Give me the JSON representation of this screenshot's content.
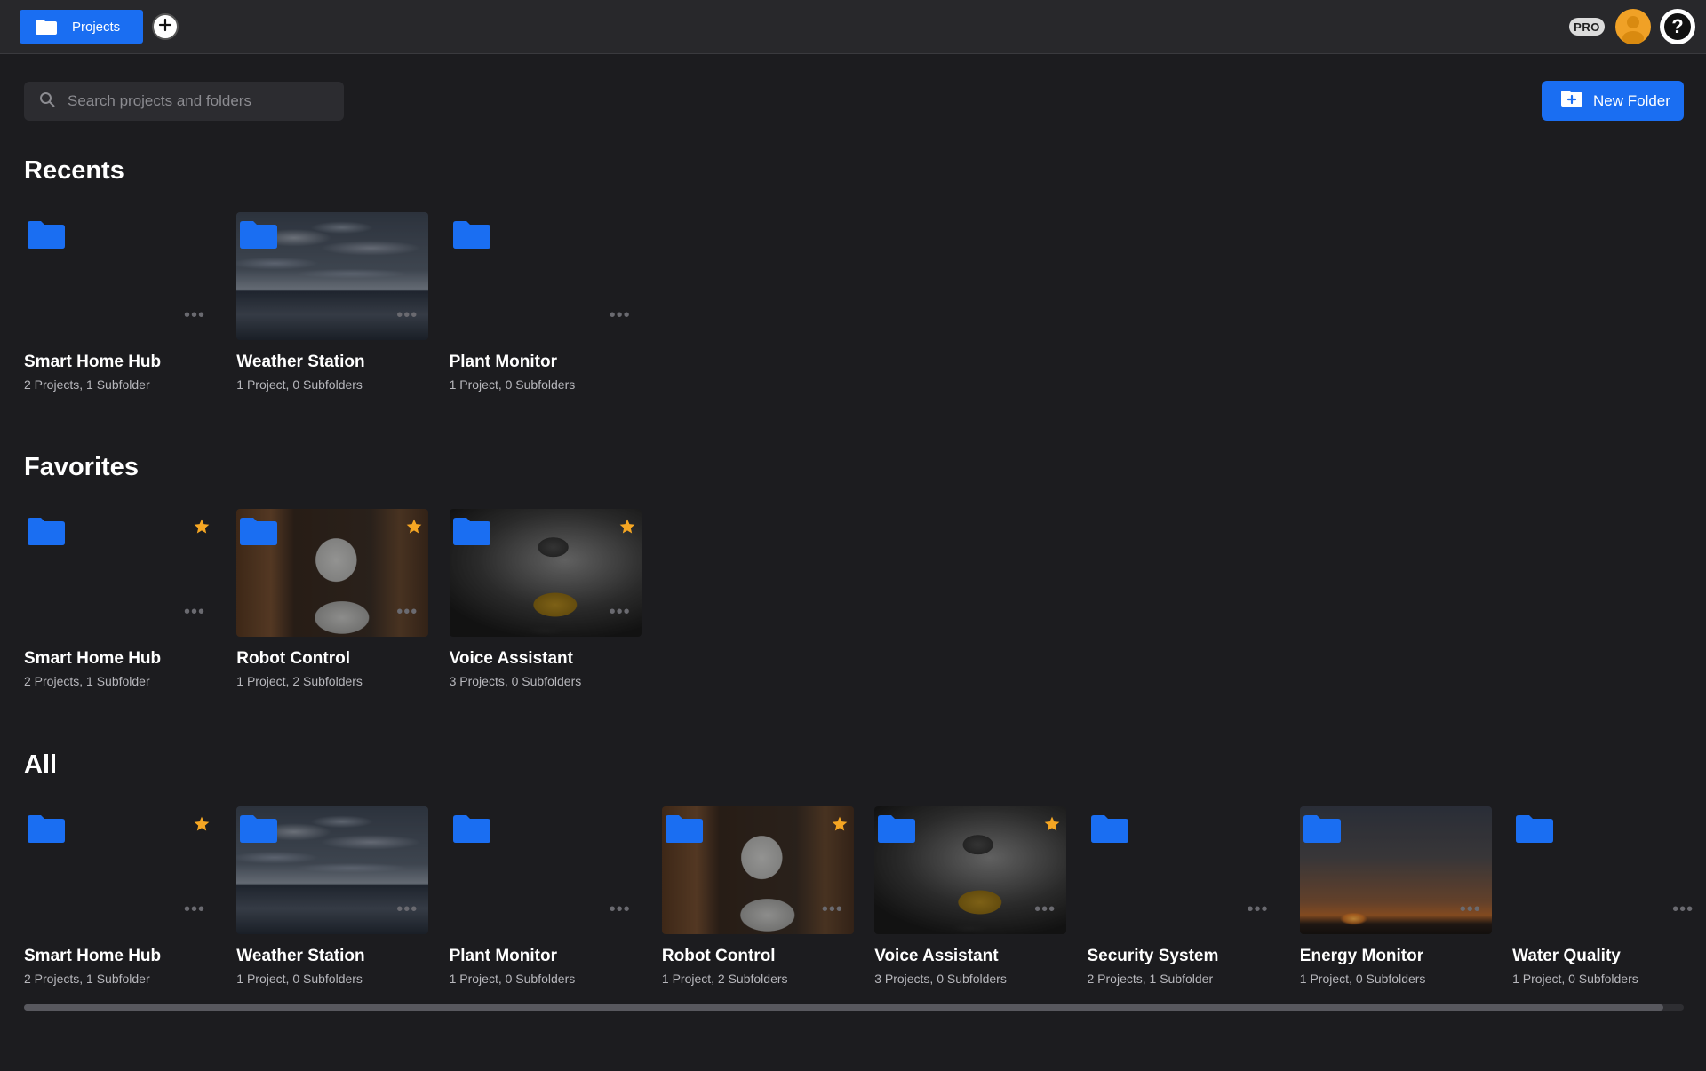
{
  "topbar": {
    "tab_label": "Projects",
    "pro_label": "PRO",
    "help_label": "?"
  },
  "search": {
    "placeholder": "Search projects and folders"
  },
  "new_folder_label": "New Folder",
  "sections": [
    {
      "title": "Recents",
      "cards": [
        {
          "name": "Smart Home Hub",
          "meta": "2 Projects, 1 Subfolder",
          "image": "none",
          "starred": false
        },
        {
          "name": "Weather Station",
          "meta": "1 Project, 0 Subfolders",
          "image": "clouds",
          "starred": false
        },
        {
          "name": "Plant Monitor",
          "meta": "1 Project, 0 Subfolders",
          "image": "none",
          "starred": false
        }
      ]
    },
    {
      "title": "Favorites",
      "cards": [
        {
          "name": "Smart Home Hub",
          "meta": "2 Projects, 1 Subfolder",
          "image": "none",
          "starred": true
        },
        {
          "name": "Robot Control",
          "meta": "1 Project, 2 Subfolders",
          "image": "robot",
          "starred": true
        },
        {
          "name": "Voice Assistant",
          "meta": "3 Projects, 0 Subfolders",
          "image": "walle",
          "starred": true
        }
      ]
    },
    {
      "title": "All",
      "cards": [
        {
          "name": "Smart Home Hub",
          "meta": "2 Projects, 1 Subfolder",
          "image": "none",
          "starred": true
        },
        {
          "name": "Weather Station",
          "meta": "1 Project, 0 Subfolders",
          "image": "clouds",
          "starred": false
        },
        {
          "name": "Plant Monitor",
          "meta": "1 Project, 0 Subfolders",
          "image": "none",
          "starred": false
        },
        {
          "name": "Robot Control",
          "meta": "1 Project, 2 Subfolders",
          "image": "robot",
          "starred": true
        },
        {
          "name": "Voice Assistant",
          "meta": "3 Projects, 0 Subfolders",
          "image": "walle",
          "starred": true
        },
        {
          "name": "Security System",
          "meta": "2 Projects, 1 Subfolder",
          "image": "none",
          "starred": false
        },
        {
          "name": "Energy Monitor",
          "meta": "1 Project, 0 Subfolders",
          "image": "sunset",
          "starred": false
        },
        {
          "name": "Water Quality",
          "meta": "1 Project, 0 Subfolders",
          "image": "none",
          "starred": false
        }
      ]
    }
  ],
  "colors": {
    "accent": "#1a6ef2",
    "star": "#f5a623",
    "background": "#1c1c1f",
    "topbar": "#28282b"
  },
  "icons": [
    "folder-icon",
    "plus-icon",
    "search-icon",
    "folder-plus-icon",
    "star-icon",
    "more-icon",
    "user-icon",
    "help-icon"
  ]
}
